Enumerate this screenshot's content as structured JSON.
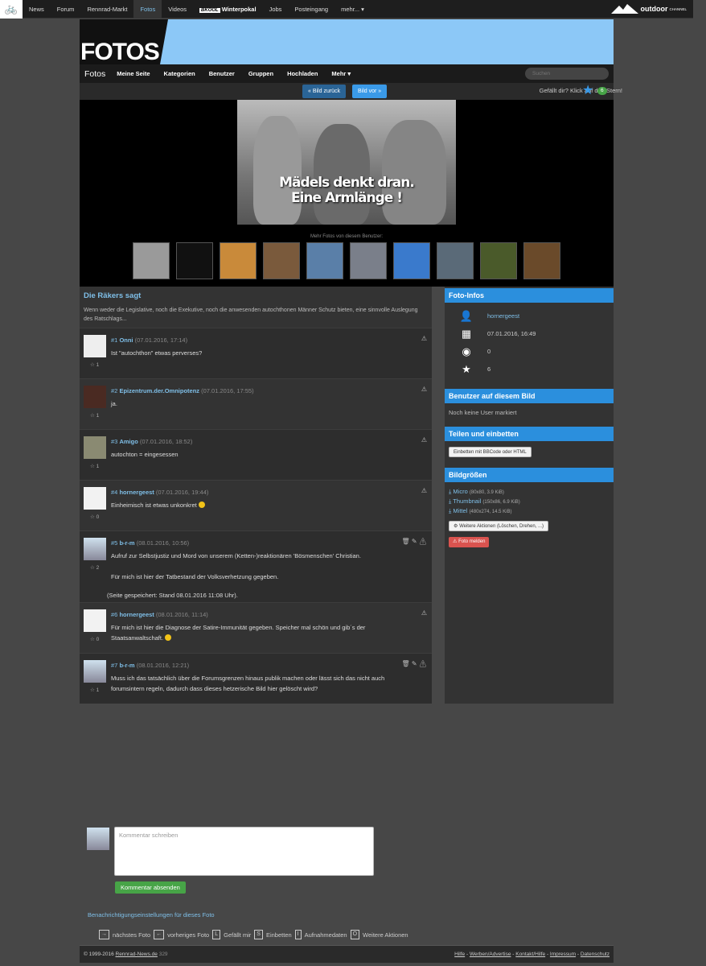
{
  "topnav": {
    "items": [
      "News",
      "Forum",
      "Rennrad-Markt",
      "Fotos",
      "Videos"
    ],
    "winter_badge": "BKOOL",
    "winter_label": "Winterpokal",
    "items2": [
      "Jobs",
      "Posteingang"
    ],
    "more": "mehr...",
    "brand": "outdoor",
    "brand_sub": "CHANNEL"
  },
  "header": {
    "title": "FOTOS"
  },
  "subnav": {
    "current": "Fotos",
    "items": [
      "Meine Seite",
      "Kategorien",
      "Benutzer",
      "Gruppen",
      "Hochladen",
      "Mehr"
    ],
    "search_placeholder": "Suchen"
  },
  "photo_nav": {
    "prev": "« Bild zurück",
    "next": "Bild vor »",
    "like_text": "Gefällt dir? Klick auf den Stern!",
    "like_count": "6"
  },
  "photo": {
    "caption_line1": "Mädels denkt dran.",
    "caption_line2": "Eine Armlänge !",
    "more_label": "Mehr Fotos von diesem Benutzer:"
  },
  "thumbnails_count": 10,
  "thumb_colors": [
    "#9a9a9a",
    "#111",
    "#c98a3a",
    "#7a5a3c",
    "#5a7fa8",
    "#7a7f8a",
    "#3a7acc",
    "#5a6a78",
    "#4a5a2a",
    "#6a4a2a"
  ],
  "album": {
    "title": "Die Räkers sagt",
    "description": "Wenn weder die Legislative, noch die Exekutive, noch die anwesenden autochthonen Männer Schutz bieten, eine sinnvolle Auslegung des Ratschlags..."
  },
  "comments": [
    {
      "num": "#1",
      "user": "Onni",
      "date": "(07.01.2016, 17:14)",
      "text": "Ist \"autochthon\" etwas perverses?",
      "stars": "1"
    },
    {
      "num": "#2",
      "user": "Epizentrum.der.Omnipotenz",
      "date": "(07.01.2016, 17:55)",
      "text": "ja.",
      "stars": "1"
    },
    {
      "num": "#3",
      "user": "Amigo",
      "date": "(07.01.2016, 18:52)",
      "text": "autochton = eingesessen",
      "stars": "1"
    },
    {
      "num": "#4",
      "user": "hornergeest",
      "date": "(07.01.2016, 19:44)",
      "text": "Einheimisch ist etwas unkonkret",
      "stars": "0"
    },
    {
      "num": "#5",
      "user": "b-r-m",
      "date": "(08.01.2016, 10:56)",
      "text": "Aufruf zur Selbstjustiz und Mord von unserem (Ketten-)reaktionären 'Bösmenschen' Christian.",
      "text2": "Für mich ist hier der Tatbestand der Volksverhetzung gegeben.",
      "text3": "(Seite gespeichert: Stand 08.01.2016 11:08 Uhr).",
      "stars": "2"
    },
    {
      "num": "#6",
      "user": "hornergeest",
      "date": "(08.01.2016, 11:14)",
      "text": "Für mich ist hier die Diagnose der Satire-Immunität gegeben. Speicher mal schön und gib´s der Staatsanwaltschaft.",
      "stars": "0"
    },
    {
      "num": "#7",
      "user": "b-r-m",
      "date": "(08.01.2016, 12:21)",
      "text": "Muss ich das tatsächlich über die Forumsgrenzen hinaus publik machen oder lässt sich das nicht auch forumsintern regeln, dadurch dass dieses hetzerische Bild hier gelöscht wird?",
      "stars": "1"
    }
  ],
  "sidebar": {
    "info_title": "Foto-Infos",
    "owner": "hornergeest",
    "date": "07.01.2016, 16:49",
    "views": "0",
    "likes": "6",
    "tagged_title": "Benutzer auf diesem Bild",
    "tagged_text": "Noch keine User markiert",
    "share_title": "Teilen und einbetten",
    "share_btn": "Einbetten mit BBCode oder HTML",
    "sizes_title": "Bildgrößen",
    "sizes": [
      {
        "name": "Micro",
        "dim": "(80x80, 3.9 KiB)"
      },
      {
        "name": "Thumbnail",
        "dim": "(150x86, 6.9 KiB)"
      },
      {
        "name": "Mittel",
        "dim": "(480x274, 14.5 KiB)"
      }
    ],
    "more_actions": "Weitere Aktionen (Löschen, Drehen, ...)",
    "report": "Foto melden"
  },
  "compose": {
    "placeholder": "Kommentar schreiben",
    "submit": "Kommentar absenden",
    "notify": "Benachrichtigungseinstellungen für dieses Foto"
  },
  "shortcuts": {
    "k1": "→",
    "l1": "nächstes Foto",
    "k2": "←",
    "l2": "vorheriges Foto",
    "k3": "L",
    "l3": "Gefällt mir",
    "k4": "S",
    "l4": "Einbetten",
    "k5": "I",
    "l5": "Aufnahmedaten",
    "k6": "O",
    "l6": "Weitere Aktionen"
  },
  "footer": {
    "copyright": "© 1999-2016",
    "site": "Rennrad-News.de",
    "num": "329",
    "links": [
      "Hilfe",
      "Werben/Advertise",
      "Kontakt/Hilfe",
      "Impressum",
      "Datenschutz"
    ]
  }
}
